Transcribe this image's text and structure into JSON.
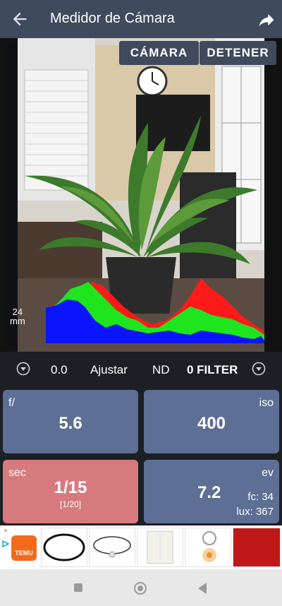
{
  "app": {
    "title": "Medidor de Cámara"
  },
  "viewer": {
    "camera_button": "CÁMARA",
    "stop_button": "DETENER",
    "focal_value": "24",
    "focal_unit": "mm"
  },
  "controls": {
    "ev_comp": "0.0",
    "adjust_label": "Ajustar",
    "nd_label": "ND",
    "filter_value": "0 FILTER"
  },
  "cards": {
    "aperture": {
      "label": "f/",
      "value": "5.6"
    },
    "iso": {
      "label": "iso",
      "value": "400"
    },
    "shutter": {
      "label": "sec",
      "value": "1/15",
      "sub": "[1/20]"
    },
    "ev": {
      "label": "ev",
      "value": "7.2",
      "fc": "fc: 34",
      "lux": "lux: 367"
    }
  },
  "ad": {
    "brand": "TEMU"
  },
  "colors": {
    "appbar": "#3f4a5c",
    "card": "#5d6f94",
    "card_alert": "#d77a7e"
  },
  "icons": [
    "back-arrow-icon",
    "share-icon",
    "chevron-down-icon",
    "nav-square-icon",
    "nav-circle-icon",
    "nav-triangle-icon"
  ]
}
